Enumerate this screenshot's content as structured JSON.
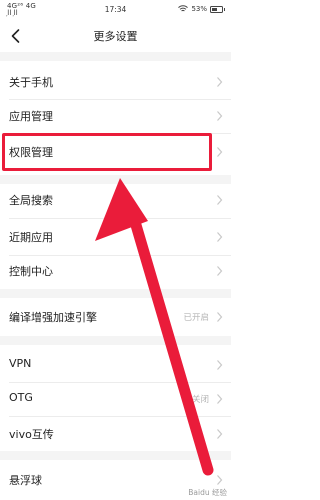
{
  "status_bar": {
    "signal_top": "4G²⁶ 4G",
    "signal_bottom": "᷊ll  ᷊ll",
    "time": "17:34",
    "battery": "53%",
    "battery_level": 0.53
  },
  "header": {
    "title": "更多设置"
  },
  "items": [
    {
      "label": "关于手机"
    },
    {
      "label": "应用管理"
    },
    {
      "label": "权限管理"
    },
    {
      "label": "全局搜索"
    },
    {
      "label": "近期应用"
    },
    {
      "label": "控制中心"
    },
    {
      "label": "编译增强加速引擎",
      "value": "已开启"
    },
    {
      "label": "VPN"
    },
    {
      "label": "OTG",
      "value": "已关闭"
    },
    {
      "label": "vivo互传"
    },
    {
      "label": "悬浮球"
    }
  ],
  "watermark": "Baidu 经验",
  "colors": {
    "annotation": "#ea1c3a",
    "chevron": "#c8c8c8",
    "value_text": "#b5b5b5"
  }
}
